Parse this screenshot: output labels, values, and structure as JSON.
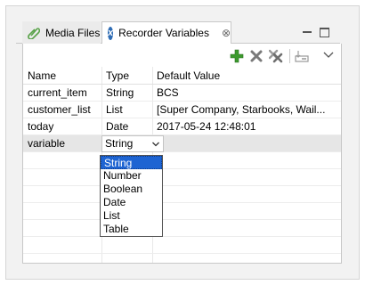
{
  "tabs": [
    {
      "label": "Media Files",
      "icon": "paperclip-icon"
    },
    {
      "label": "Recorder Variables",
      "icon": "x-logo-icon",
      "close": "⊗"
    }
  ],
  "toolbar": {
    "add": "plus-icon",
    "delete": "delete-icon",
    "delete_all": "delete-all-icon",
    "import": "import-icon",
    "menu": "view-menu-icon"
  },
  "table": {
    "headers": [
      "Name",
      "Type",
      "Default Value"
    ],
    "rows": [
      {
        "name": "current_item",
        "type": "String",
        "value": "BCS"
      },
      {
        "name": "customer_list",
        "type": "List",
        "value": "[Super Company, Starbooks, Wail..."
      },
      {
        "name": "today",
        "type": "Date",
        "value": "2017-05-24 12:48:01"
      },
      {
        "name": "variable",
        "type": "String",
        "value": ""
      }
    ]
  },
  "type_dropdown": {
    "selected": "String",
    "options": [
      "String",
      "Number",
      "Boolean",
      "Date",
      "List",
      "Table"
    ]
  },
  "colors": {
    "accent_green": "#3c9a2e",
    "selection_blue": "#1e64d2",
    "logo_blue": "#2f6db5"
  }
}
